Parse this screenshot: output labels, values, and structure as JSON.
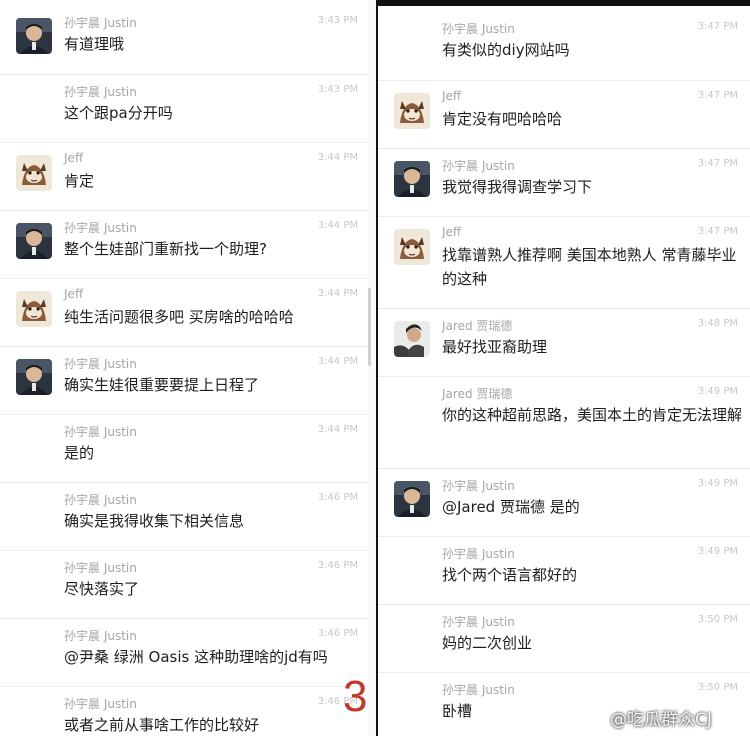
{
  "left": {
    "messages": [
      {
        "name": "孙宇晨 Justin",
        "time": "3:43 PM",
        "text": "有道理哦",
        "avatar": "justin"
      },
      {
        "name": "孙宇晨 Justin",
        "time": "3:43 PM",
        "text": "这个跟pa分开吗",
        "avatar": ""
      },
      {
        "name": "Jeff",
        "time": "3:44 PM",
        "text": "肯定",
        "avatar": "jeff"
      },
      {
        "name": "孙宇晨 Justin",
        "time": "3:44 PM",
        "text": "整个生娃部门重新找一个助理?",
        "avatar": "justin"
      },
      {
        "name": "Jeff",
        "time": "3:44 PM",
        "text": "纯生活问题很多吧 买房啥的哈哈哈",
        "avatar": "jeff"
      },
      {
        "name": "孙宇晨 Justin",
        "time": "3:44 PM",
        "text": "确实生娃很重要要提上日程了",
        "avatar": "justin"
      },
      {
        "name": "孙宇晨 Justin",
        "time": "3:44 PM",
        "text": "是的",
        "avatar": ""
      },
      {
        "name": "孙宇晨 Justin",
        "time": "3:46 PM",
        "text": "确实是我得收集下相关信息",
        "avatar": ""
      },
      {
        "name": "孙宇晨 Justin",
        "time": "3:46 PM",
        "text": "尽快落实了",
        "avatar": ""
      },
      {
        "name": "孙宇晨 Justin",
        "time": "3:46 PM",
        "text": "@尹桑 绿洲 Oasis 这种助理啥的jd有吗",
        "avatar": ""
      },
      {
        "name": "孙宇晨 Justin",
        "time": "3:46 PM",
        "text": "或者之前从事啥工作的比较好",
        "avatar": ""
      }
    ]
  },
  "right": {
    "messages": [
      {
        "name": "孙宇晨 Justin",
        "time": "3:47 PM",
        "text": "有类似的diy网站吗",
        "avatar": ""
      },
      {
        "name": "Jeff",
        "time": "3:47 PM",
        "text": "肯定没有吧哈哈哈",
        "avatar": "jeff"
      },
      {
        "name": "孙宇晨 Justin",
        "time": "3:47 PM",
        "text": "我觉得我得调查学习下",
        "avatar": "justin"
      },
      {
        "name": "Jeff",
        "time": "3:47 PM",
        "text": "找靠谱熟人推荐啊 美国本地熟人 常青藤毕业的这种",
        "avatar": "jeff"
      },
      {
        "name": "Jared 贾瑞德",
        "time": "3:48 PM",
        "text": "最好找亚裔助理",
        "avatar": "jared"
      },
      {
        "name": "Jared 贾瑞德",
        "time": "3:49 PM",
        "text": "你的这种超前思路，美国本土的肯定无法理解",
        "avatar": ""
      },
      {
        "name": "孙宇晨 Justin",
        "time": "3:49 PM",
        "text": "@Jared 贾瑞德 是的",
        "avatar": "justin"
      },
      {
        "name": "孙宇晨 Justin",
        "time": "3:49 PM",
        "text": "找个两个语言都好的",
        "avatar": ""
      },
      {
        "name": "孙宇晨 Justin",
        "time": "3:50 PM",
        "text": "妈的二次创业",
        "avatar": ""
      },
      {
        "name": "孙宇晨 Justin",
        "time": "3:50 PM",
        "text": "卧槽",
        "avatar": ""
      }
    ]
  },
  "page_marker": "3",
  "watermark": "@吃瓜群众CJ",
  "colors": {
    "name": "#a6a6a6",
    "time": "#c8c8c8",
    "text": "#1e1e1e",
    "divider": "#111111",
    "marker": "#c0392b"
  }
}
